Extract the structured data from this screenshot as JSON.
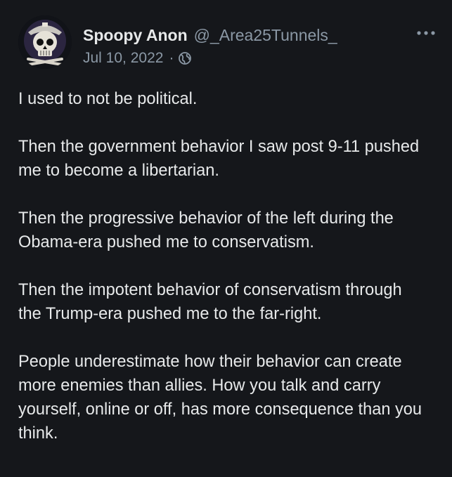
{
  "tweet": {
    "display_name": "Spoopy Anon",
    "handle": "@_Area25Tunnels_",
    "date": "Jul 10, 2022",
    "separator": "·",
    "audience_icon": "globe-icon",
    "more_icon": "more-horizontal-icon",
    "paragraphs": [
      "I used to not be political.",
      "Then the government behavior I saw post 9-11 pushed me to become a libertarian.",
      "Then the progressive behavior of the left during the Obama-era pushed me to conservatism.",
      "Then the impotent behavior of conservatism through the Trump-era pushed me to the far-right.",
      "People underestimate how their behavior can create more enemies than allies. How you talk and carry yourself, online or off, has more consequence than you think."
    ]
  },
  "colors": {
    "background": "#15171b",
    "primary_text": "#e7e9ea",
    "secondary_text": "#8b98a5"
  }
}
